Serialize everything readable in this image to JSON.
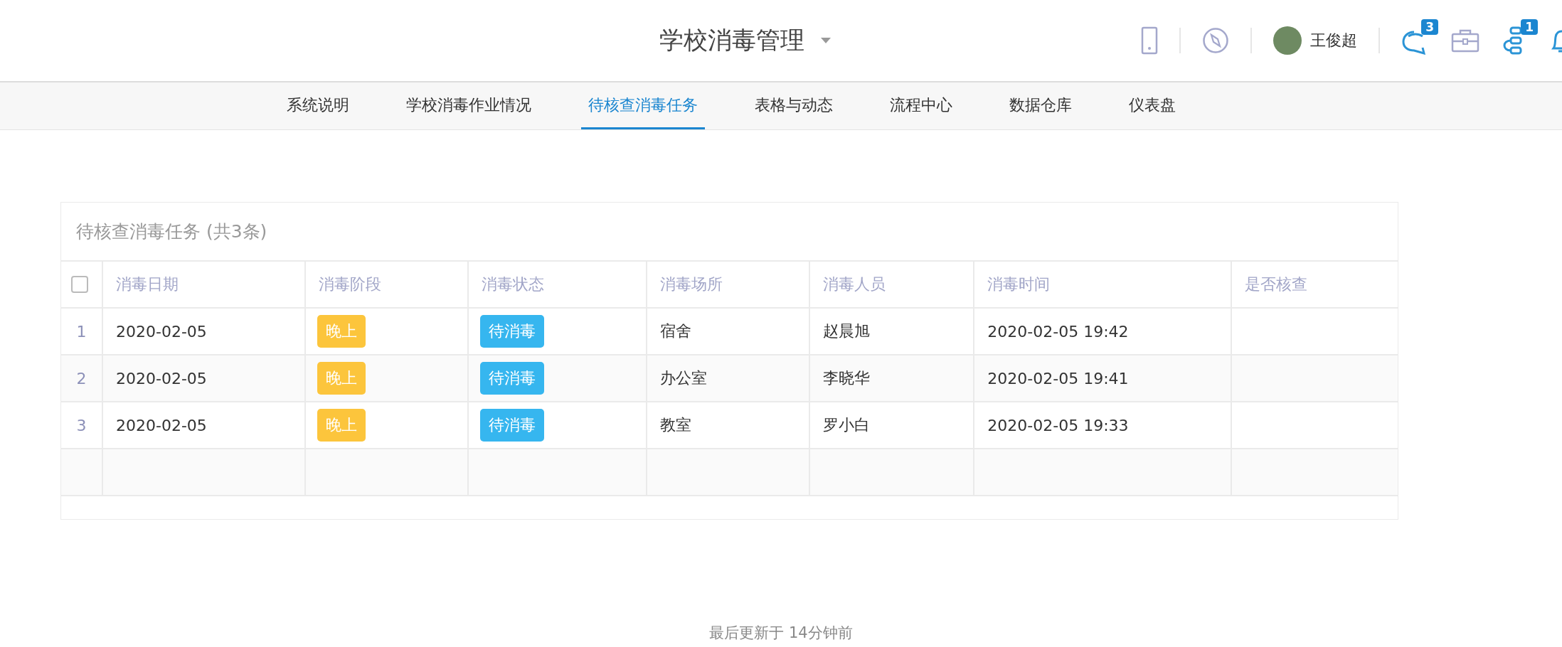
{
  "header": {
    "title": "学校消毒管理",
    "user": {
      "name": "王俊超"
    },
    "badges": {
      "messages": "3",
      "flows": "1"
    }
  },
  "tabs": [
    {
      "label": "系统说明",
      "selected": false
    },
    {
      "label": "学校消毒作业情况",
      "selected": false
    },
    {
      "label": "待核查消毒任务",
      "selected": true
    },
    {
      "label": "表格与动态",
      "selected": false
    },
    {
      "label": "流程中心",
      "selected": false
    },
    {
      "label": "数据仓库",
      "selected": false
    },
    {
      "label": "仪表盘",
      "selected": false
    }
  ],
  "table": {
    "title": "待核查消毒任务 (共3条)",
    "select_all": {
      "checked": false
    },
    "columns": [
      "消毒日期",
      "消毒阶段",
      "消毒状态",
      "消毒场所",
      "消毒人员",
      "消毒时间",
      "是否核查"
    ],
    "rows": [
      {
        "index": "1",
        "date": "2020-02-05",
        "stage": "晚上",
        "status": "待消毒",
        "place": "宿舍",
        "person": "赵晨旭",
        "time": "2020-02-05 19:42"
      },
      {
        "index": "2",
        "date": "2020-02-05",
        "stage": "晚上",
        "status": "待消毒",
        "place": "办公室",
        "person": "李晓华",
        "time": "2020-02-05 19:41"
      },
      {
        "index": "3",
        "date": "2020-02-05",
        "stage": "晚上",
        "status": "待消毒",
        "place": "教室",
        "person": "罗小白",
        "time": "2020-02-05 19:33"
      }
    ]
  },
  "footer": "最后更新于 14分钟前"
}
